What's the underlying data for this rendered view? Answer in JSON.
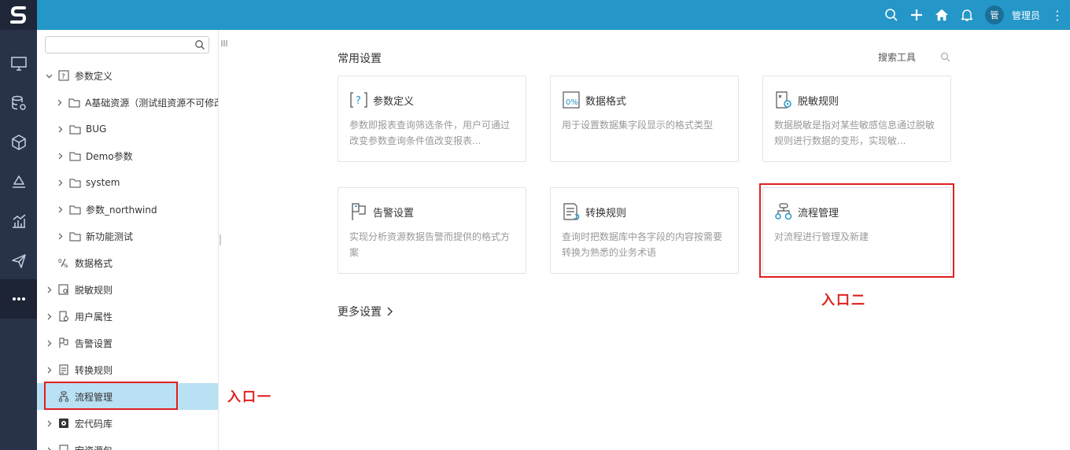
{
  "topbar": {
    "user_initial": "管",
    "user_name": "管理员",
    "more_symbol": "⋮"
  },
  "tree": {
    "search_placeholder": "",
    "items": [
      {
        "label": "参数定义",
        "expanded": true
      },
      {
        "label": "A基础资源（测试组资源不可修改"
      },
      {
        "label": "BUG"
      },
      {
        "label": "Demo参数"
      },
      {
        "label": "system"
      },
      {
        "label": "参数_northwind"
      },
      {
        "label": "新功能测试"
      },
      {
        "label": "数据格式"
      },
      {
        "label": "脱敏规则"
      },
      {
        "label": "用户属性"
      },
      {
        "label": "告警设置"
      },
      {
        "label": "转换规则"
      },
      {
        "label": "流程管理",
        "selected": true
      },
      {
        "label": "宏代码库"
      },
      {
        "label": "宏资源包"
      }
    ]
  },
  "main": {
    "section_title": "常用设置",
    "search_tool": "搜索工具",
    "cards": [
      {
        "title": "参数定义",
        "desc": "参数即报表查询筛选条件，用户可通过改变参数查询条件值改变报表..."
      },
      {
        "title": "数据格式",
        "desc": "用于设置数据集字段显示的格式类型"
      },
      {
        "title": "脱敏规则",
        "desc": "数据脱敏是指对某些敏感信息通过脱敏规则进行数据的变形，实现敏..."
      },
      {
        "title": "告警设置",
        "desc": "实现分析资源数据告警而提供的格式方案"
      },
      {
        "title": "转换规则",
        "desc": "查询时把数据库中各字段的内容按需要转换为熟悉的业务术语"
      },
      {
        "title": "流程管理",
        "desc": "对流程进行管理及新建"
      }
    ],
    "more_settings": "更多设置"
  },
  "annotations": {
    "entry_one": "入口一",
    "entry_two": "入口二"
  },
  "colors": {
    "topbar": "#2496c8",
    "rail": "#28334a",
    "selected_row": "#b9e0f3",
    "annotation": "#e02020",
    "icon_blue": "#2496c8"
  }
}
